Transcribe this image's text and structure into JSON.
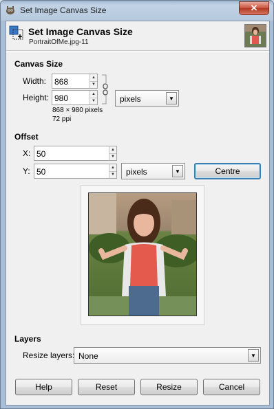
{
  "window": {
    "title": "Set Image Canvas Size",
    "close": "✕"
  },
  "header": {
    "title": "Set Image Canvas Size",
    "subtitle": "PortraitOfMe.jpg-11"
  },
  "canvas_size": {
    "section": "Canvas Size",
    "width_label": "Width:",
    "width_value": "868",
    "height_label": "Height:",
    "height_value": "980",
    "units": "pixels",
    "info_size": "868 × 980 pixels",
    "info_res": "72 ppi"
  },
  "offset": {
    "section": "Offset",
    "x_label": "X:",
    "x_value": "50",
    "y_label": "Y:",
    "y_value": "50",
    "units": "pixels",
    "centre_label": "Centre"
  },
  "layers": {
    "section": "Layers",
    "resize_label": "Resize layers:",
    "resize_value": "None"
  },
  "buttons": {
    "help": "Help",
    "reset": "Reset",
    "resize": "Resize",
    "cancel": "Cancel"
  }
}
